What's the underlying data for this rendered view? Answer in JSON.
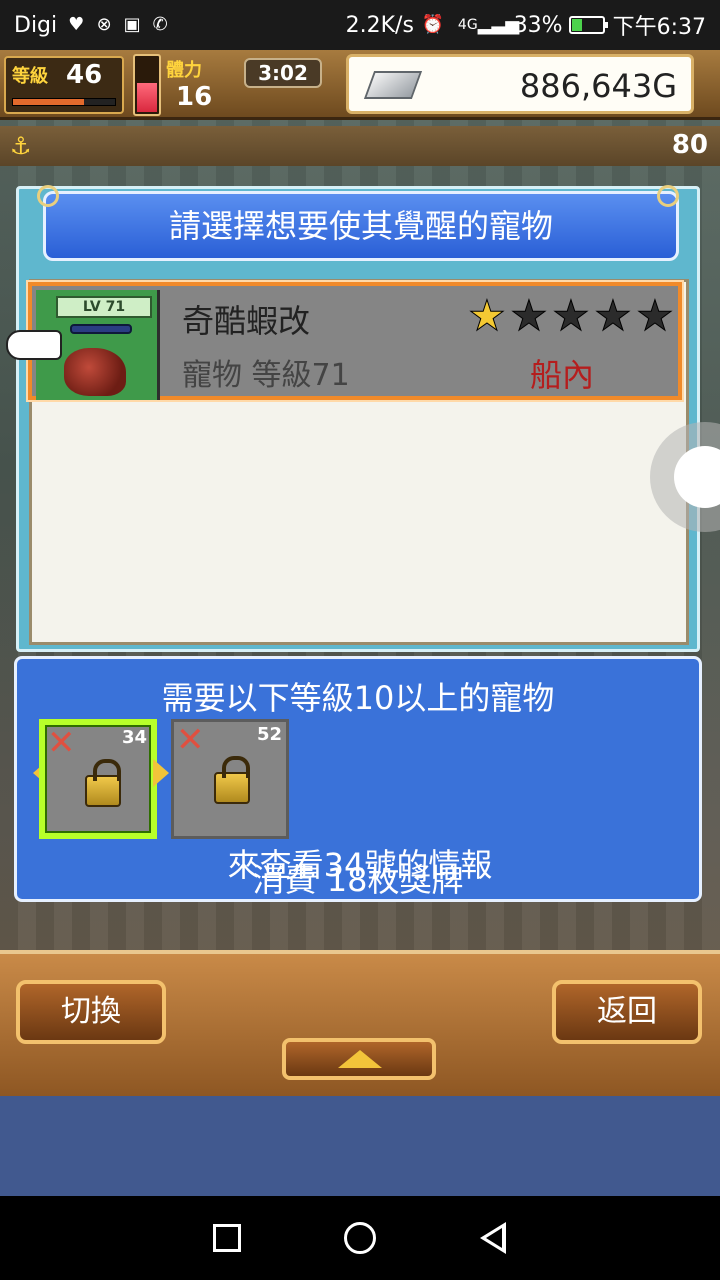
{
  "status_bar": {
    "carrier": "Digi",
    "network_speed": "2.2K/s",
    "signal_label": "4G",
    "battery_percent": "33%",
    "time": "下午6:37",
    "battery_level": 0.33
  },
  "hud": {
    "level_label": "等級",
    "level_value": "46",
    "stamina_label": "體力",
    "stamina_value": "16",
    "timer": "3:02",
    "gold": "886,643G",
    "exp_fraction": 0.7,
    "stamina_fraction": 0.5
  },
  "background": {
    "right_number": "80"
  },
  "pet_dialog": {
    "title": "請選擇想要使其覺醒的寵物",
    "pet": {
      "lv_tag": "LV 71",
      "name": "奇酷蝦改",
      "subtitle": "寵物 等級71",
      "location": "船內",
      "stars_total": 5,
      "stars_filled": 1
    }
  },
  "requirements": {
    "title": "需要以下等級10以上的寵物",
    "slots": [
      {
        "number": "34"
      },
      {
        "number": "52"
      }
    ],
    "cost_line": "消費 18枚獎牌",
    "info_line": "來查看34號的情報"
  },
  "bottom_bar": {
    "switch_label": "切換",
    "back_label": "返回"
  },
  "colors": {
    "dialog_blue": "#2a5fd6",
    "highlight_orange": "#f08a2a",
    "selected_green": "#b8ff2a",
    "location_red": "#b51d1d"
  },
  "icons": {
    "star_filled": "star-icon",
    "lock": "lock-icon",
    "pointer": "pointing-hand-icon"
  }
}
